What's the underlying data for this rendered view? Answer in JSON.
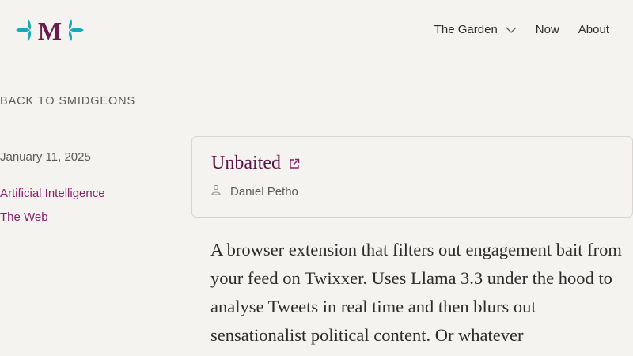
{
  "header": {
    "logo_letter": "M",
    "logo_colors": {
      "letter": "#6b1a4e",
      "leaves": "#1ba8b8"
    },
    "nav": [
      {
        "label": "The Garden",
        "has_dropdown": true
      },
      {
        "label": "Now"
      },
      {
        "label": "About"
      }
    ]
  },
  "back_link": "BACK TO SMIDGEONS",
  "meta": {
    "date": "January 11, 2025",
    "tags": [
      "Artificial Intelligence",
      "The Web"
    ]
  },
  "card": {
    "title": "Unbaited",
    "author": "Daniel Petho",
    "external_icon": "external-link-icon",
    "author_icon": "person-icon"
  },
  "body_text": "A browser extension that filters out engagement bait from your feed on Twixxer. Uses Llama 3.3 under the hood to analyse Tweets in real time and then blurs out sensationalist political content. Or whatever",
  "colors": {
    "background": "#f5f3f0",
    "accent": "#8a1e6a",
    "title": "#5b1546"
  }
}
